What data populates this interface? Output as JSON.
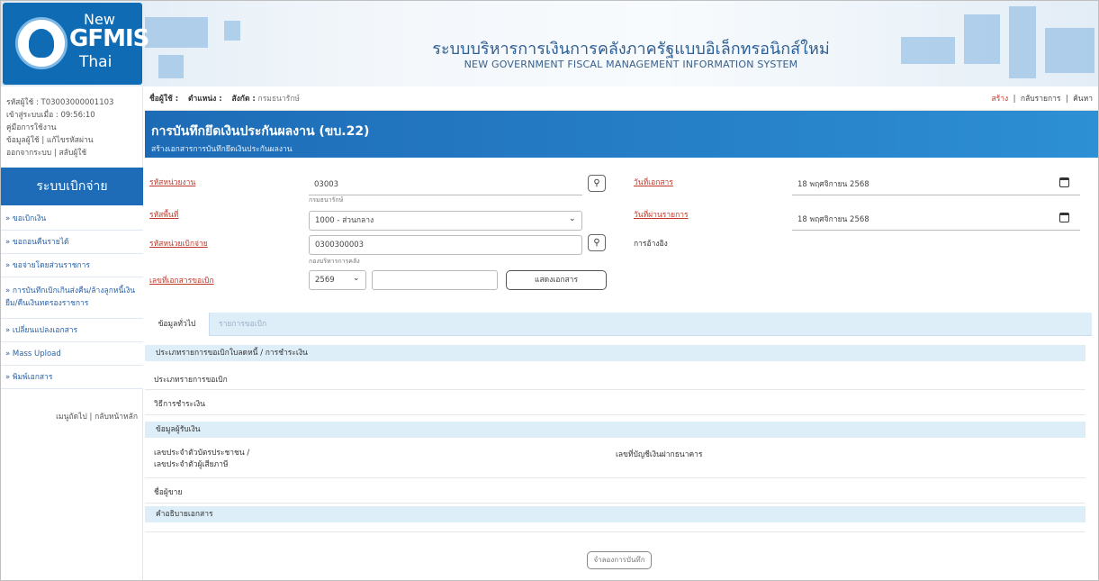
{
  "header": {
    "logo_new": "New",
    "logo_gfmis": "GFMIS",
    "logo_thai": "Thai",
    "title_th": "ระบบบริหารการเงินการคลังภาครัฐแบบอิเล็กทรอนิกส์ใหม่",
    "title_en": "NEW GOVERNMENT FISCAL MANAGEMENT INFORMATION SYSTEM"
  },
  "sidebar": {
    "user_id": "รหัสผู้ใช้ : T03003000001103",
    "login_time": "เข้าสู่ระบบเมื่อ : 09:56:10",
    "manual": "คู่มือการใช้งาน",
    "user_info": "ข้อมูลผู้ใช้",
    "change_password": "แก้ไขรหัสผ่าน",
    "logout": "ออกจากระบบ",
    "switch_user": "สลับผู้ใช้",
    "system_title": "ระบบเบิกจ่าย",
    "menu": [
      {
        "label": "» ขอเบิกเงิน"
      },
      {
        "label": "» ขอถอนคืนรายได้"
      },
      {
        "label": "» ขอจ่ายโดยส่วนราชการ"
      },
      {
        "label": "» การบันทึกเบิกเกินส่งคืน/ล้างลูกหนี้เงินยืม/คืนเงินทดรองราชการ"
      },
      {
        "label": "» เปลี่ยนแปลงเอกสาร"
      },
      {
        "label": "» Mass Upload"
      },
      {
        "label": "» พิมพ์เอกสาร"
      }
    ],
    "next_menu": "เมนูถัดไป",
    "back_home": "กลับหน้าหลัก"
  },
  "topbar": {
    "user_label": "ชื่อผู้ใช้ :",
    "position_label": "ตำแหน่ง :",
    "affiliation_label": "สังกัด :",
    "affiliation_value": "กรมธนารักษ์",
    "create": "สร้าง",
    "back_to_list": "กลับรายการ",
    "search": "ค้นหา"
  },
  "banner": {
    "title": "การบันทึกยึดเงินประกันผลงาน (ขบ.22)",
    "subtitle": "สร้างเอกสารการบันทึกยึดเงินประกันผลงาน"
  },
  "form": {
    "agency_code_label": "รหัสหน่วยงาน",
    "agency_code_value": "03003",
    "agency_name": "กรมธนารักษ์",
    "area_code_label": "รหัสพื้นที่",
    "area_code_value": "1000 - ส่วนกลาง",
    "disburse_unit_label": "รหัสหน่วยเบิกจ่าย",
    "disburse_unit_value": "0300300003",
    "disburse_unit_name": "กองบริหารการคลัง",
    "request_doc_label": "เลขที่เอกสารขอเบิก",
    "year_value": "2569",
    "show_doc_button": "แสดงเอกสาร",
    "doc_date_label": "วันที่เอกสาร",
    "doc_date_value": "18 พฤศจิกายน 2568",
    "post_date_label": "วันที่ผ่านรายการ",
    "post_date_value": "18 พฤศจิกายน 2568",
    "reference_label": "การอ้างอิง"
  },
  "tabs": [
    {
      "label": "ข้อมูลทั่วไป",
      "active": true
    },
    {
      "label": "รายการขอเบิก",
      "active": false
    }
  ],
  "details": {
    "section_type": "ประเภทรายการขอเบิกใบลดหนี้ / การชำระเงิน",
    "request_type": "ประเภทรายการขอเบิก",
    "payment_method": "วิธีการชำระเงิน",
    "section_payee": "ข้อมูลผู้รับเงิน",
    "id_card_line1": "เลขประจำตัวบัตรประชาชน /",
    "id_card_line2": "เลขประจำตัวผู้เสียภาษี",
    "bank_account": "เลขที่บัญชีเงินฝากธนาคาร",
    "seller_name": "ชื่อผู้ขาย",
    "section_desc": "คำอธิบายเอกสาร"
  },
  "save_button": "จำลองการบันทึก"
}
